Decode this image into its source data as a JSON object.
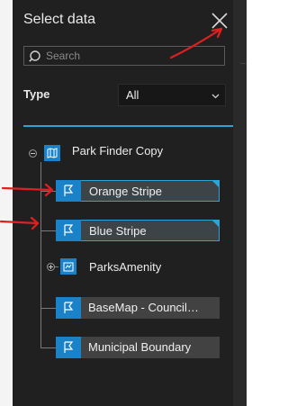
{
  "panel": {
    "title": "Select data",
    "search": {
      "placeholder": "Search",
      "value": ""
    },
    "type_filter": {
      "label": "Type",
      "selected": "All"
    }
  },
  "tree": {
    "root": {
      "label": "Park Finder Copy",
      "icon": "map-icon",
      "expanded": true
    },
    "items": [
      {
        "label": "Orange Stripe",
        "icon": "feature-layer-icon",
        "selected": true
      },
      {
        "label": "Blue Stripe",
        "icon": "feature-layer-icon",
        "selected": true
      },
      {
        "label": "ParksAmenity",
        "icon": "group-layer-icon",
        "expandable": true
      },
      {
        "label": "BaseMap - Council…",
        "icon": "feature-layer-icon",
        "selected": false
      },
      {
        "label": "Municipal Boundary",
        "icon": "feature-layer-icon",
        "selected": false
      }
    ]
  },
  "annotations": {
    "arrow_color": "#e02020"
  },
  "colors": {
    "accent": "#2ea3d6",
    "icon_blue": "#1a82c8",
    "panel_bg": "#202020",
    "item_bg": "#424242"
  }
}
